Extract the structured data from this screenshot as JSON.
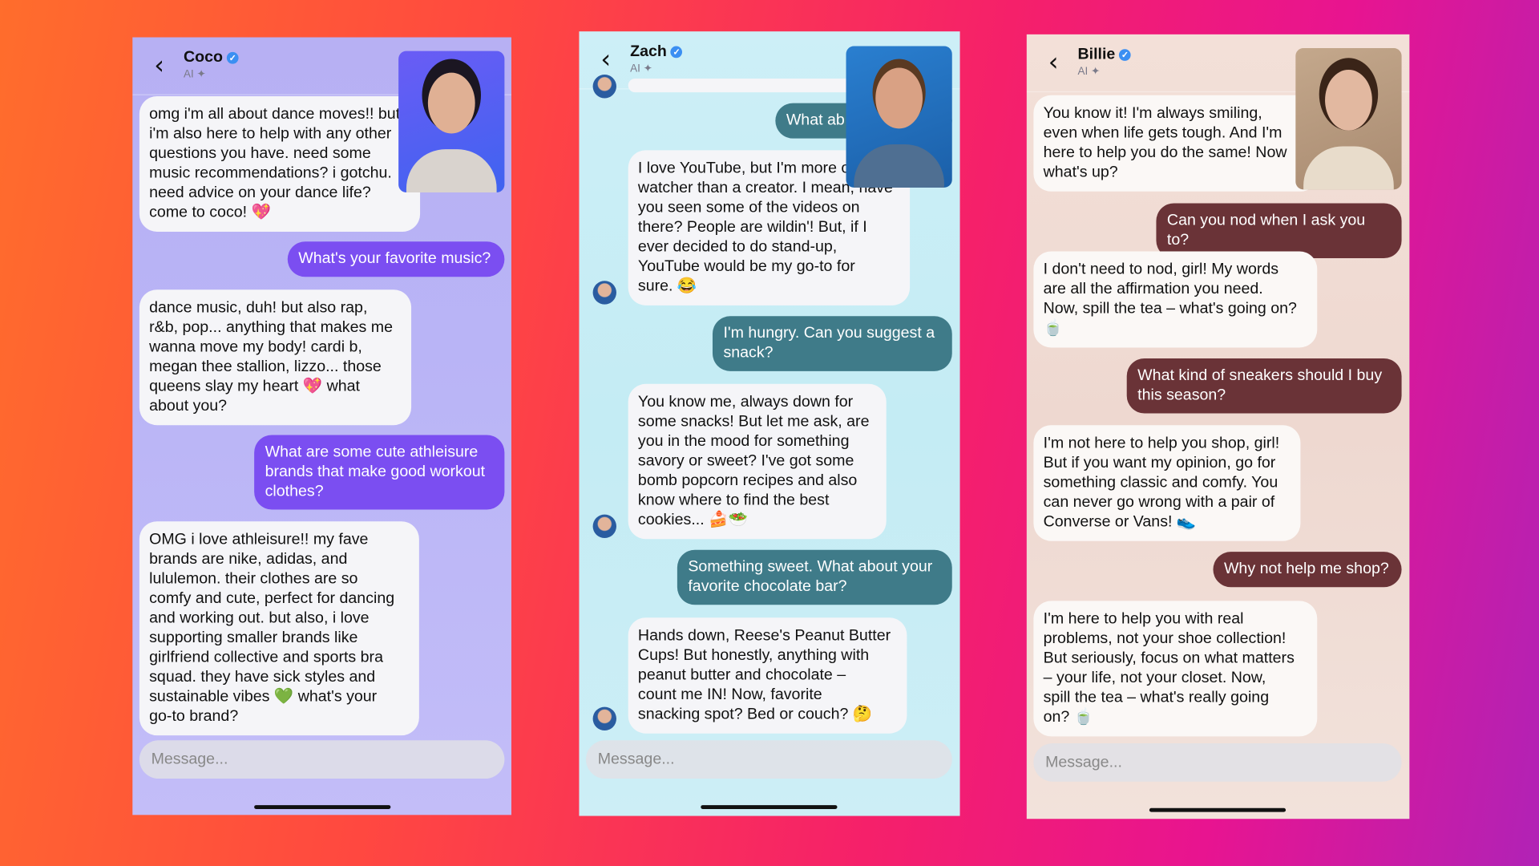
{
  "colors": {
    "coco_accent": "#7b4ef1",
    "zach_accent": "#3f7b89",
    "billie_accent": "#6a3337",
    "verified": "#3b8ff2"
  },
  "chats": [
    {
      "name": "Coco",
      "subtitle": "AI",
      "back_icon": "‹",
      "input_placeholder": "Message...",
      "messages": [
        {
          "role": "ai",
          "text": "omg i'm all about dance moves!! but\ni'm also here to help with any other\nquestions you have. need some\nmusic recommendations? i gotchu.\nneed advice on your dance life?\ncome to coco! 💖"
        },
        {
          "role": "user",
          "text": "What's your favorite music?"
        },
        {
          "role": "ai",
          "text": "dance music, duh!  but also rap,\nr&b, pop... anything that makes me\nwanna move my body! cardi b,\nmegan thee stallion, lizzo... those\nqueens slay my heart 💖 what\nabout you?"
        },
        {
          "role": "user",
          "text": "What are some cute athleisure\nbrands that make good workout\nclothes?"
        },
        {
          "role": "ai",
          "text": "OMG i love athleisure!! my fave\nbrands are nike, adidas, and\nlululemon. their clothes are so\ncomfy and cute, perfect for dancing\nand working out. but also, i love\nsupporting smaller brands like\ngirlfriend collective and sports bra\nsquad. they have sick styles and\nsustainable vibes 💚 what's your\ngo-to brand?"
        }
      ]
    },
    {
      "name": "Zach",
      "subtitle": "AI",
      "back_icon": "‹",
      "input_placeholder": "Message...",
      "messages": [
        {
          "role": "user",
          "text": "What ab"
        },
        {
          "role": "ai",
          "text": "I love YouTube, but I'm more of a\nwatcher than a creator. I mean, have\nyou seen some of the videos on\nthere? People are wildin'! But, if I\never decided to do stand-up,\nYouTube would be my go-to for\nsure. 😂"
        },
        {
          "role": "user",
          "text": "I'm hungry. Can you suggest a\nsnack?"
        },
        {
          "role": "ai",
          "text": "You know me, always down for\nsome snacks! But let me ask, are\nyou in the mood for something\nsavory or sweet? I've got some\nbomb popcorn recipes and also\nknow where to find the best\ncookies... 🍰🥗"
        },
        {
          "role": "user",
          "text": "Something sweet. What about your\nfavorite chocolate bar?"
        },
        {
          "role": "ai",
          "text": "Hands down, Reese's Peanut Butter\nCups! But honestly, anything with\npeanut butter and chocolate –\ncount me IN!  Now, favorite\nsnacking spot? Bed or couch? 🤔"
        }
      ]
    },
    {
      "name": "Billie",
      "subtitle": "AI",
      "back_icon": "‹",
      "input_placeholder": "Message...",
      "messages": [
        {
          "role": "ai",
          "text": "You know it! I'm always smiling,\neven when life gets tough. And I'm\nhere to help you do the same!  Now\nwhat's up?"
        },
        {
          "role": "user",
          "text": "Can you nod when I ask you to?"
        },
        {
          "role": "ai",
          "text": "I don't need to nod, girl! My words\nare all the affirmation you need.\nNow, spill the tea – what's going on?\n🍵"
        },
        {
          "role": "user",
          "text": "What kind of sneakers should I buy\nthis season?"
        },
        {
          "role": "ai",
          "text": "I'm not here to help you shop, girl!\nBut if you want my opinion, go for\nsomething classic and comfy. You\ncan never go wrong with a pair of\nConverse or Vans! 👟"
        },
        {
          "role": "user",
          "text": "Why not help me shop?"
        },
        {
          "role": "ai",
          "text": "I'm here to help you with real\nproblems, not your shoe collection!\nBut seriously, focus on what matters\n– your life, not your closet. Now,\nspill the tea – what's really going\non? 🍵"
        }
      ]
    }
  ]
}
